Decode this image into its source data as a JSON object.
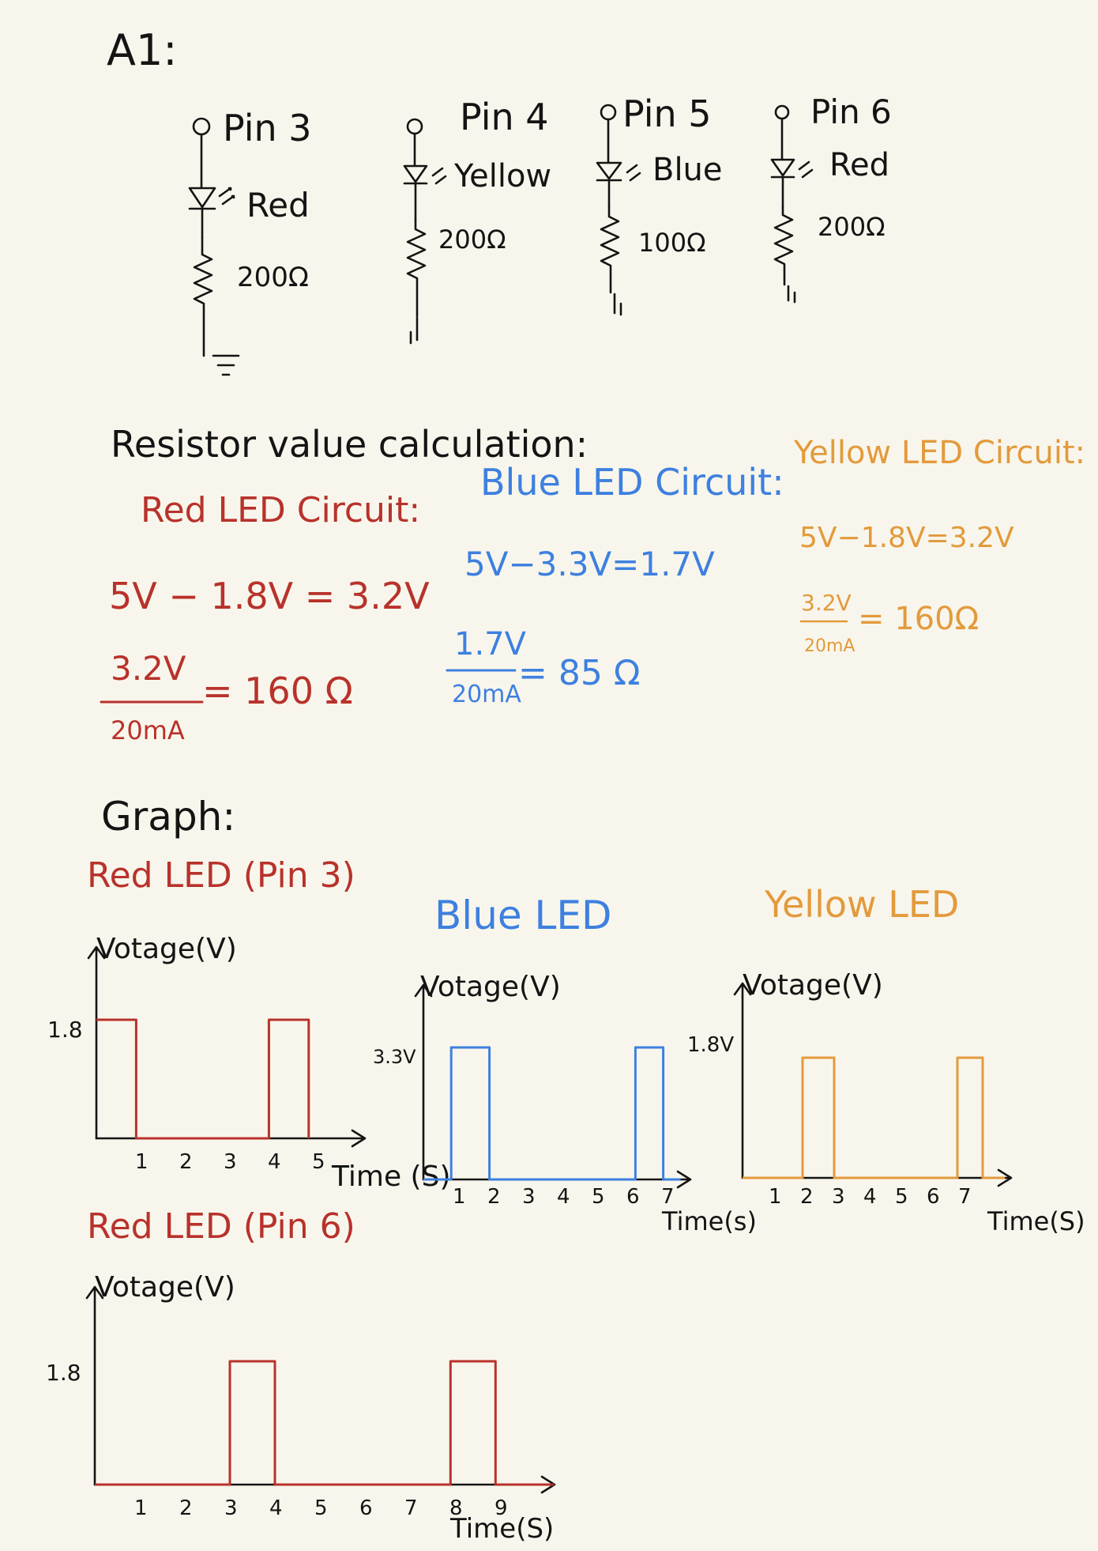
{
  "heading": "A1:",
  "circuits": [
    {
      "pin": "Pin 3",
      "led": "Red",
      "resistor": "200Ω"
    },
    {
      "pin": "Pin 4",
      "led": "Yellow",
      "resistor": "200Ω"
    },
    {
      "pin": "Pin 5",
      "led": "Blue",
      "resistor": "100Ω"
    },
    {
      "pin": "Pin 6",
      "led": "Red",
      "resistor": "200Ω"
    }
  ],
  "calc": {
    "title": "Resistor value calculation:",
    "red": {
      "title": "Red LED Circuit:",
      "line1": "5V − 1.8V = 3.2V",
      "num": "3.2V",
      "den": "20mA",
      "result": "= 160 Ω"
    },
    "blue": {
      "title": "Blue LED Circuit:",
      "line1": "5V−3.3V=1.7V",
      "num": "1.7V",
      "den": "20mA",
      "result": "= 85 Ω"
    },
    "yellow": {
      "title": "Yellow LED Circuit:",
      "line1": "5V−1.8V=3.2V",
      "num": "3.2V",
      "den": "20mA",
      "result": "= 160Ω"
    }
  },
  "graph_title": "Graph:",
  "colors": {
    "red": "#b8322b",
    "blue": "#3d80e0",
    "orange": "#e39a3c",
    "ink": "#141414"
  },
  "chart_data": [
    {
      "type": "line",
      "title": "Red LED (Pin 3)",
      "ylabel": "Votage(V)",
      "xlabel": "Time (S)",
      "ytick": "1.8",
      "xticks": [
        "1",
        "2",
        "3",
        "4",
        "5"
      ],
      "x": [
        0,
        0.9,
        0.9,
        3.9,
        3.9,
        4.8,
        4.8
      ],
      "y": [
        1.8,
        1.8,
        0,
        0,
        1.8,
        1.8,
        0
      ],
      "ylim": [
        0,
        2.2
      ],
      "color": "#b8322b"
    },
    {
      "type": "line",
      "title": "Blue LED",
      "ylabel": "Votage(V)",
      "xlabel": "Time(s)",
      "ytick": "3.3V",
      "xticks": [
        "1",
        "2",
        "3",
        "4",
        "5",
        "6",
        "7"
      ],
      "x": [
        0,
        0.8,
        0.8,
        1.9,
        1.9,
        6.1,
        6.1,
        6.9,
        6.9,
        7.4
      ],
      "y": [
        0,
        0,
        3.3,
        3.3,
        0,
        0,
        3.3,
        3.3,
        0,
        0
      ],
      "ylim": [
        0,
        4.0
      ],
      "color": "#3d80e0"
    },
    {
      "type": "line",
      "title": "Yellow LED",
      "ylabel": "Votage(V)",
      "xlabel": "Time(S)",
      "ytick": "1.8V",
      "xticks": [
        "1",
        "2",
        "3",
        "4",
        "5",
        "6",
        "7"
      ],
      "x": [
        0,
        1.9,
        1.9,
        2.9,
        2.9,
        6.8,
        6.8,
        7.6,
        7.6,
        8.3
      ],
      "y": [
        0,
        0,
        1.8,
        1.8,
        0,
        0,
        1.8,
        1.8,
        0,
        0
      ],
      "ylim": [
        0,
        2.1
      ],
      "color": "#e39a3c"
    },
    {
      "type": "line",
      "title": "Red LED (Pin 6)",
      "ylabel": "Votage(V)",
      "xlabel": "Time(S)",
      "ytick": "1.8",
      "xticks": [
        "1",
        "2",
        "3",
        "4",
        "5",
        "6",
        "7",
        "8",
        "9"
      ],
      "x": [
        0,
        3,
        3,
        4,
        4,
        7.9,
        7.9,
        8.9,
        8.9,
        10.2
      ],
      "y": [
        0,
        0,
        1.8,
        1.8,
        0,
        0,
        1.8,
        1.8,
        0,
        0
      ],
      "ylim": [
        0,
        2.1
      ],
      "color": "#b8322b"
    }
  ]
}
